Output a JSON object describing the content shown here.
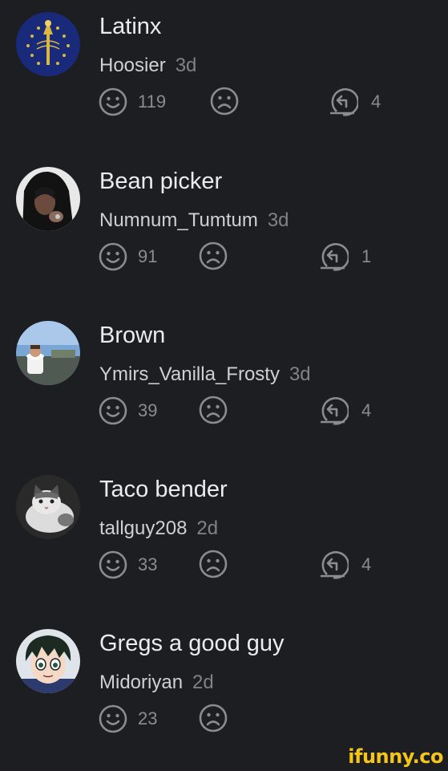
{
  "comments": [
    {
      "text": "Latinx",
      "user": "Hoosier",
      "time": "3d",
      "smiles": "119",
      "replies": "4"
    },
    {
      "text": "Bean picker",
      "user": "Numnum_Tumtum",
      "time": "3d",
      "smiles": "91",
      "replies": "1"
    },
    {
      "text": "Brown",
      "user": "Ymirs_Vanilla_Frosty",
      "time": "3d",
      "smiles": "39",
      "replies": "4"
    },
    {
      "text": "Taco bender",
      "user": "tallguy208",
      "time": "2d",
      "smiles": "33",
      "replies": "4"
    },
    {
      "text": "Gregs a good guy",
      "user": "Midoriyan",
      "time": "2d",
      "smiles": "23",
      "replies": ""
    }
  ],
  "watermark": "ifunny.co",
  "colors": {
    "background": "#1d1e22",
    "icon": "#8a8c92",
    "watermark": "#f5c518"
  },
  "icons": [
    "smile-icon",
    "frown-icon",
    "reply-icon"
  ]
}
